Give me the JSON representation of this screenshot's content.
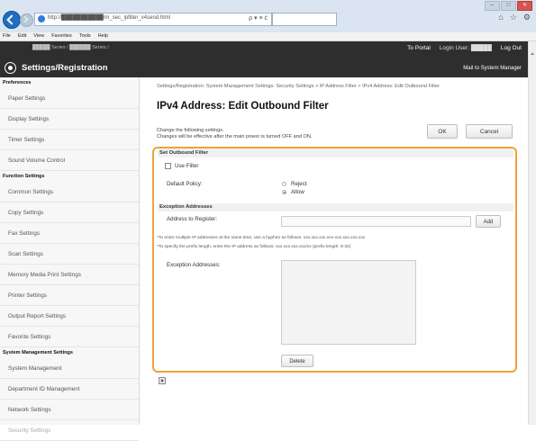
{
  "browser": {
    "url": "http://███████████/m_sec_ipfilter_v4send.html",
    "addr_tools": "ρ ▾ ≡ ć",
    "window_controls": [
      "–",
      "□",
      "✕"
    ],
    "chrome_icons": [
      "⌂",
      "☆",
      "⚙"
    ],
    "menu": [
      "File",
      "Edit",
      "View",
      "Favorites",
      "Tools",
      "Help"
    ]
  },
  "header": {
    "device": "█████ Series / ██████ Series /",
    "title": "Settings/Registration",
    "to_portal": "To Portal",
    "login_user": "Login User: █████",
    "logout": "Log Out",
    "mail": "Mail to System Manager"
  },
  "sidebar": {
    "preferences": "Preferences",
    "pref_items": [
      "Paper Settings",
      "Display Settings",
      "Timer Settings",
      "Sound Volume Control"
    ],
    "function": "Function Settings",
    "func_items": [
      "Common Settings",
      "Copy Settings",
      "Fax Settings",
      "Scan Settings",
      "Memory Media Print Settings",
      "Printer Settings",
      "Output Report Settings",
      "Favorite Settings"
    ],
    "system": "System Management Settings",
    "sys_items": [
      "System Management",
      "Department ID Management",
      "Network Settings",
      "Security Settings"
    ]
  },
  "main": {
    "breadcrumb": "Settings/Registration: System Management Settings: Security Settings > IP Address Filter > IPv4 Address: Edit Outbound Filter",
    "title": "IPv4 Address: Edit Outbound Filter",
    "instruction1": "Change the following settings.",
    "instruction2": "Changes will be effective after the main power is turned OFF and ON.",
    "ok": "OK",
    "cancel": "Cancel",
    "section_title": "Set Outbound Filter",
    "use_filter": "Use Filter",
    "use_filter_checked": false,
    "default_policy_label": "Default Policy:",
    "policy_options": [
      "Reject",
      "Allow"
    ],
    "policy_selected": "Allow",
    "exception_heading": "Exception Addresses",
    "address_label": "Address to Register:",
    "address_value": "",
    "add": "Add",
    "note1": "*To enter multiple IP addresses at the same time, use a hyphen as follows. xxx.xxx.xxx.xxx-xxx.xxx.xxx.xxx",
    "note2": "*To specify the prefix length, enter the IP address as follows: xxx.xxx.xxx.xxx/xx (prefix length: 8-32)",
    "exceptions_label": "Exception Addresses:",
    "exceptions": [],
    "delete": "Delete",
    "help_icon": "▣"
  }
}
